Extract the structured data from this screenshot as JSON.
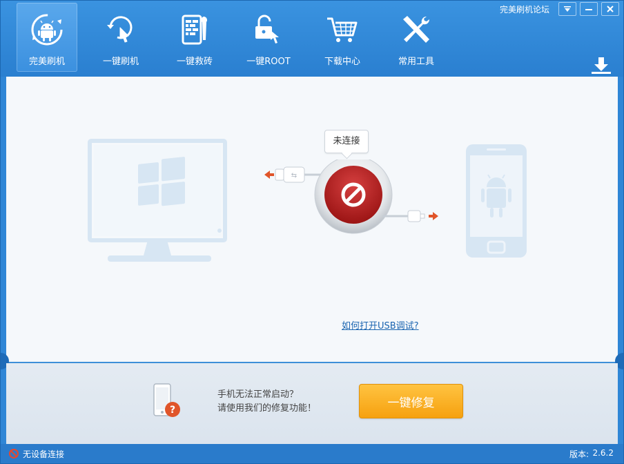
{
  "window": {
    "forum_link": "完美刷机论坛",
    "controls": [
      "menu",
      "minimize",
      "close"
    ]
  },
  "nav": {
    "items": [
      {
        "label": "完美刷机",
        "icon": "android-refresh-icon",
        "active": true
      },
      {
        "label": "一键刷机",
        "icon": "one-click-flash-icon",
        "active": false
      },
      {
        "label": "一键救砖",
        "icon": "brick-repair-icon",
        "active": false
      },
      {
        "label": "一键ROOT",
        "icon": "root-unlock-icon",
        "active": false
      },
      {
        "label": "下载中心",
        "icon": "shopping-cart-icon",
        "active": false
      },
      {
        "label": "常用工具",
        "icon": "tools-icon",
        "active": false
      }
    ]
  },
  "connection": {
    "status": "未连接",
    "usb_help": "如何打开USB调试?"
  },
  "repair": {
    "line1": "手机无法正常启动？",
    "line2": "请使用我们的修复功能！",
    "button": "一键修复"
  },
  "statusbar": {
    "device_status": "无设备连接",
    "version_label": "版本:",
    "version_value": "2.6.2"
  },
  "colors": {
    "header": "#2f86d6",
    "accent_orange": "#f6a10f",
    "disconnect_red": "#b71c1c",
    "link": "#1a64b0"
  }
}
